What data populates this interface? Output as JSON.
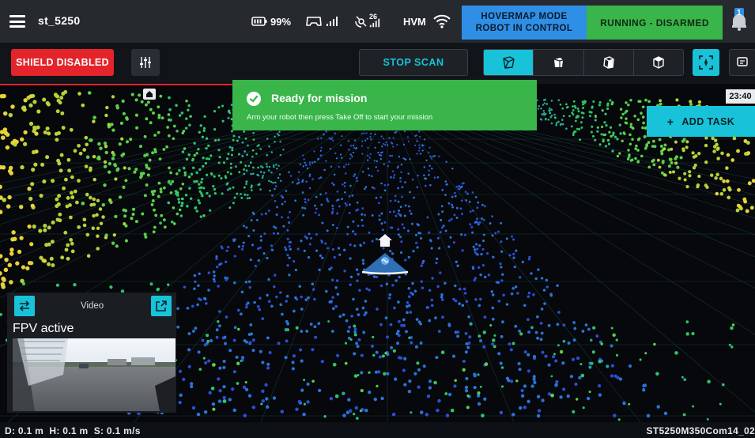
{
  "topbar": {
    "robot_name": "st_5250",
    "battery": "99%",
    "hvm_label": "HVM",
    "signal_num": "26",
    "mode_line1": "HOVERMAP MODE",
    "mode_line2": "ROBOT IN CONTROL",
    "state": "RUNNING - DISARMED",
    "notification_count": "1"
  },
  "toolbar": {
    "shield_label": "SHIELD DISABLED",
    "stop_scan_label": "STOP SCAN",
    "view_icons": [
      "cube-perspective-icon",
      "cube-front-icon",
      "cube-side-icon",
      "cube-top-icon"
    ],
    "active_view_index": 0
  },
  "viewport": {
    "clock": "23:40",
    "add_task_label": "ADD TASK",
    "add_task_plus": "+"
  },
  "toast": {
    "title": "Ready for mission",
    "message": "Arm your robot then press Take Off to start your mission"
  },
  "video": {
    "label": "Video",
    "status": "FPV active"
  },
  "statusbar": {
    "stats": "D: 0.1 m  H: 0.1 m  S: 0.1 m/s",
    "mission_id": "ST5250M350Com14_02"
  },
  "colors": {
    "accent": "#18c2d8",
    "danger": "#e3242b",
    "success": "#39b54a",
    "mode_blue": "#2f8fe6",
    "topbar_bg": "#26292e"
  }
}
